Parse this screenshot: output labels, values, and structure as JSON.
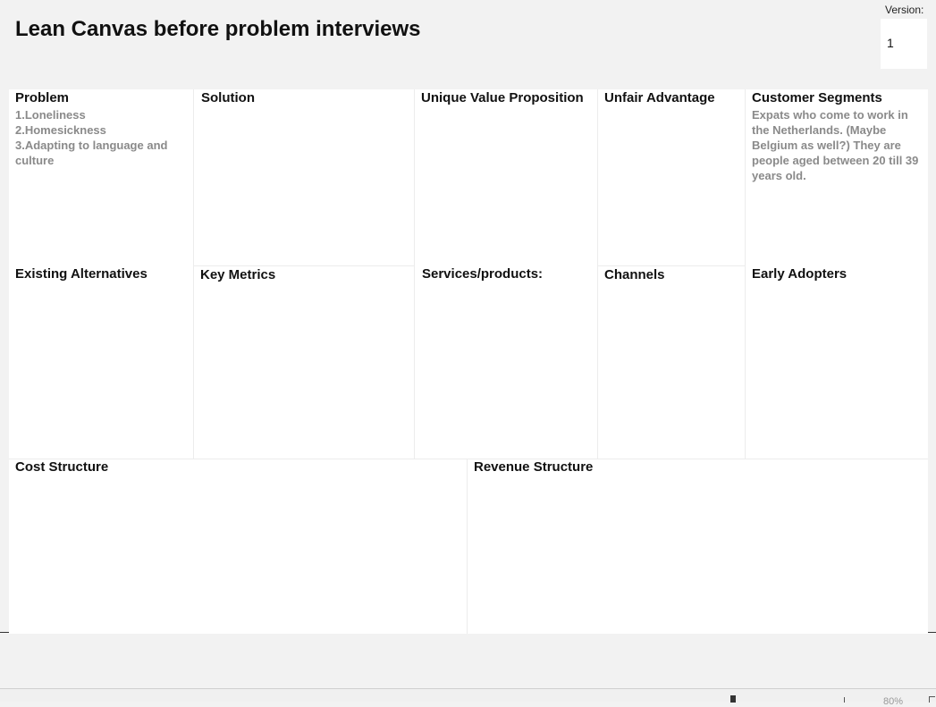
{
  "title": "Lean Canvas before problem interviews",
  "version": {
    "label": "Version:",
    "value": "1"
  },
  "canvas": {
    "problem": {
      "title": "Problem",
      "items": [
        "1.Loneliness",
        "2.Homesickness",
        "3.Adapting to language and culture"
      ]
    },
    "solution": {
      "title": "Solution"
    },
    "uvp": {
      "title": "Unique Value Proposition"
    },
    "unfair_advantage": {
      "title": "Unfair Advantage"
    },
    "customer_segments": {
      "title": "Customer Segments",
      "text": "Expats who come to work in the Netherlands. (Maybe Belgium as well?) They are people aged between 20 till 39 years old."
    },
    "existing_alternatives": {
      "title": "Existing Alternatives"
    },
    "key_metrics": {
      "title": "Key Metrics"
    },
    "services_products": {
      "title": "Services/products:"
    },
    "channels": {
      "title": "Channels"
    },
    "early_adopters": {
      "title": "Early Adopters"
    },
    "cost_structure": {
      "title": "Cost Structure"
    },
    "revenue_structure": {
      "title": "Revenue Structure"
    }
  },
  "status_bar": {
    "zoom_text": "80%"
  },
  "colors": {
    "background": "#f2f2f2",
    "card": "#ffffff",
    "body_text": "#8a8a8a",
    "heading_text": "#111111"
  }
}
